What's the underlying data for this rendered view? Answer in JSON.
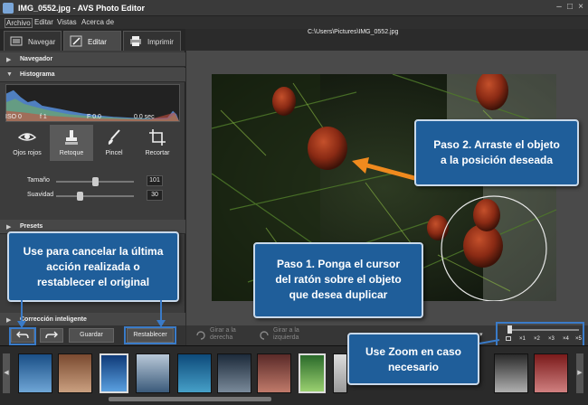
{
  "window": {
    "title": "IMG_0552.jpg  -  AVS Photo Editor"
  },
  "menu": [
    "Archivo",
    "Editar",
    "Vistas",
    "Acerca de"
  ],
  "tabs": [
    {
      "label": "Navegar",
      "icon": "photos-icon"
    },
    {
      "label": "Editar",
      "icon": "edit-icon"
    },
    {
      "label": "Imprimir",
      "icon": "print-icon"
    }
  ],
  "filepath": "C:\\Users\\Pictures\\IMG_0552.jpg",
  "sections": {
    "navigator": "Navegador",
    "histogram": "Histograma",
    "presets": "Presets",
    "auto_correct": "Corrección inteligente"
  },
  "exif": {
    "iso": "ISO 0",
    "f": "f 1",
    "f_value": "F 0.0",
    "shutter": "0.0 sec"
  },
  "tools": [
    {
      "label": "Ojos rojos",
      "icon": "eye-icon"
    },
    {
      "label": "Retoque",
      "icon": "brush-stamp-icon"
    },
    {
      "label": "Pincel",
      "icon": "paint-brush-icon"
    },
    {
      "label": "Recortar",
      "icon": "crop-icon"
    }
  ],
  "sliders": [
    {
      "label": "Tamaño",
      "value": "101",
      "fraction": 0.5
    },
    {
      "label": "Suavidad",
      "value": "30",
      "fraction": 0.3
    }
  ],
  "buttons": {
    "undo_icon": "undo-icon",
    "redo_icon": "redo-icon",
    "save": "Guardar",
    "reset": "Restablecer"
  },
  "rotate": {
    "right_1": "Girar a la",
    "right_2": "derecha",
    "left_1": "Girar a la",
    "left_2": "izquierda"
  },
  "zoom": {
    "labels": [
      "×1",
      "×2",
      "×3",
      "×4",
      "×5"
    ],
    "fraction": 0.0
  },
  "callouts": {
    "step2": "Paso 2. Arraste el objeto\na la posición deseada",
    "step1": "Paso 1. Ponga el cursor\ndel ratón sobre el objeto\nque desea duplicar",
    "cancel": "Use para cancelar la última\nacción realizada o\nrestablecer el original",
    "zoom": "Use Zoom en caso\nnecesario"
  },
  "colors": {
    "accent": "#1f5e9a",
    "highlight": "#3a7bc8",
    "arrow": "#f08a1e"
  }
}
